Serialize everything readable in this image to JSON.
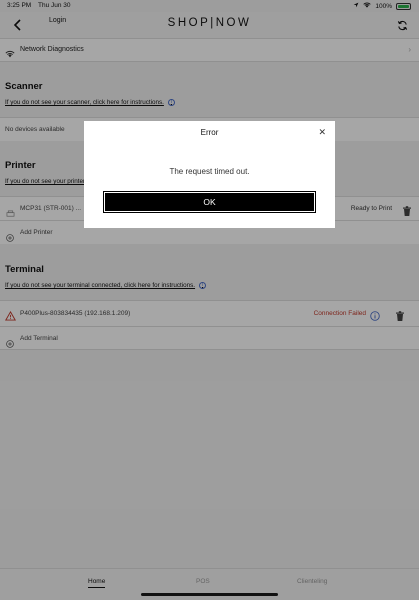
{
  "status_bar": {
    "time": "3:25 PM",
    "date": "Thu Jun 30",
    "battery": "100%"
  },
  "header": {
    "login_label": "Login",
    "logo": "SHOP|NOW"
  },
  "network_diagnostics": {
    "label": "Network Diagnostics"
  },
  "scanner": {
    "title": "Scanner",
    "help_link": "If you do not see your scanner, click here for instructions.",
    "empty_text": "No devices available"
  },
  "printer": {
    "title": "Printer",
    "help_link": "If you do not see your printer connected, click here for instructions.",
    "device_name": "MCP31 (STR-001) ...",
    "device_status": "Ready to Print",
    "add_label": "Add Printer"
  },
  "terminal": {
    "title": "Terminal",
    "help_link": "If you do not see your terminal connected, click here for instructions.",
    "device_name": "P400Plus-803834435 (192.168.1.209)",
    "device_status": "Connection Failed",
    "add_label": "Add Terminal"
  },
  "bottom_nav": {
    "tabs": [
      "Home",
      "POS",
      "Clienteling"
    ],
    "active": "Home"
  },
  "modal": {
    "title": "Error",
    "message": "The request timed out.",
    "ok_label": "OK"
  },
  "colors": {
    "error_red": "#c0392b",
    "info_blue": "#4a6dc8",
    "battery_green": "#2bb24c"
  }
}
